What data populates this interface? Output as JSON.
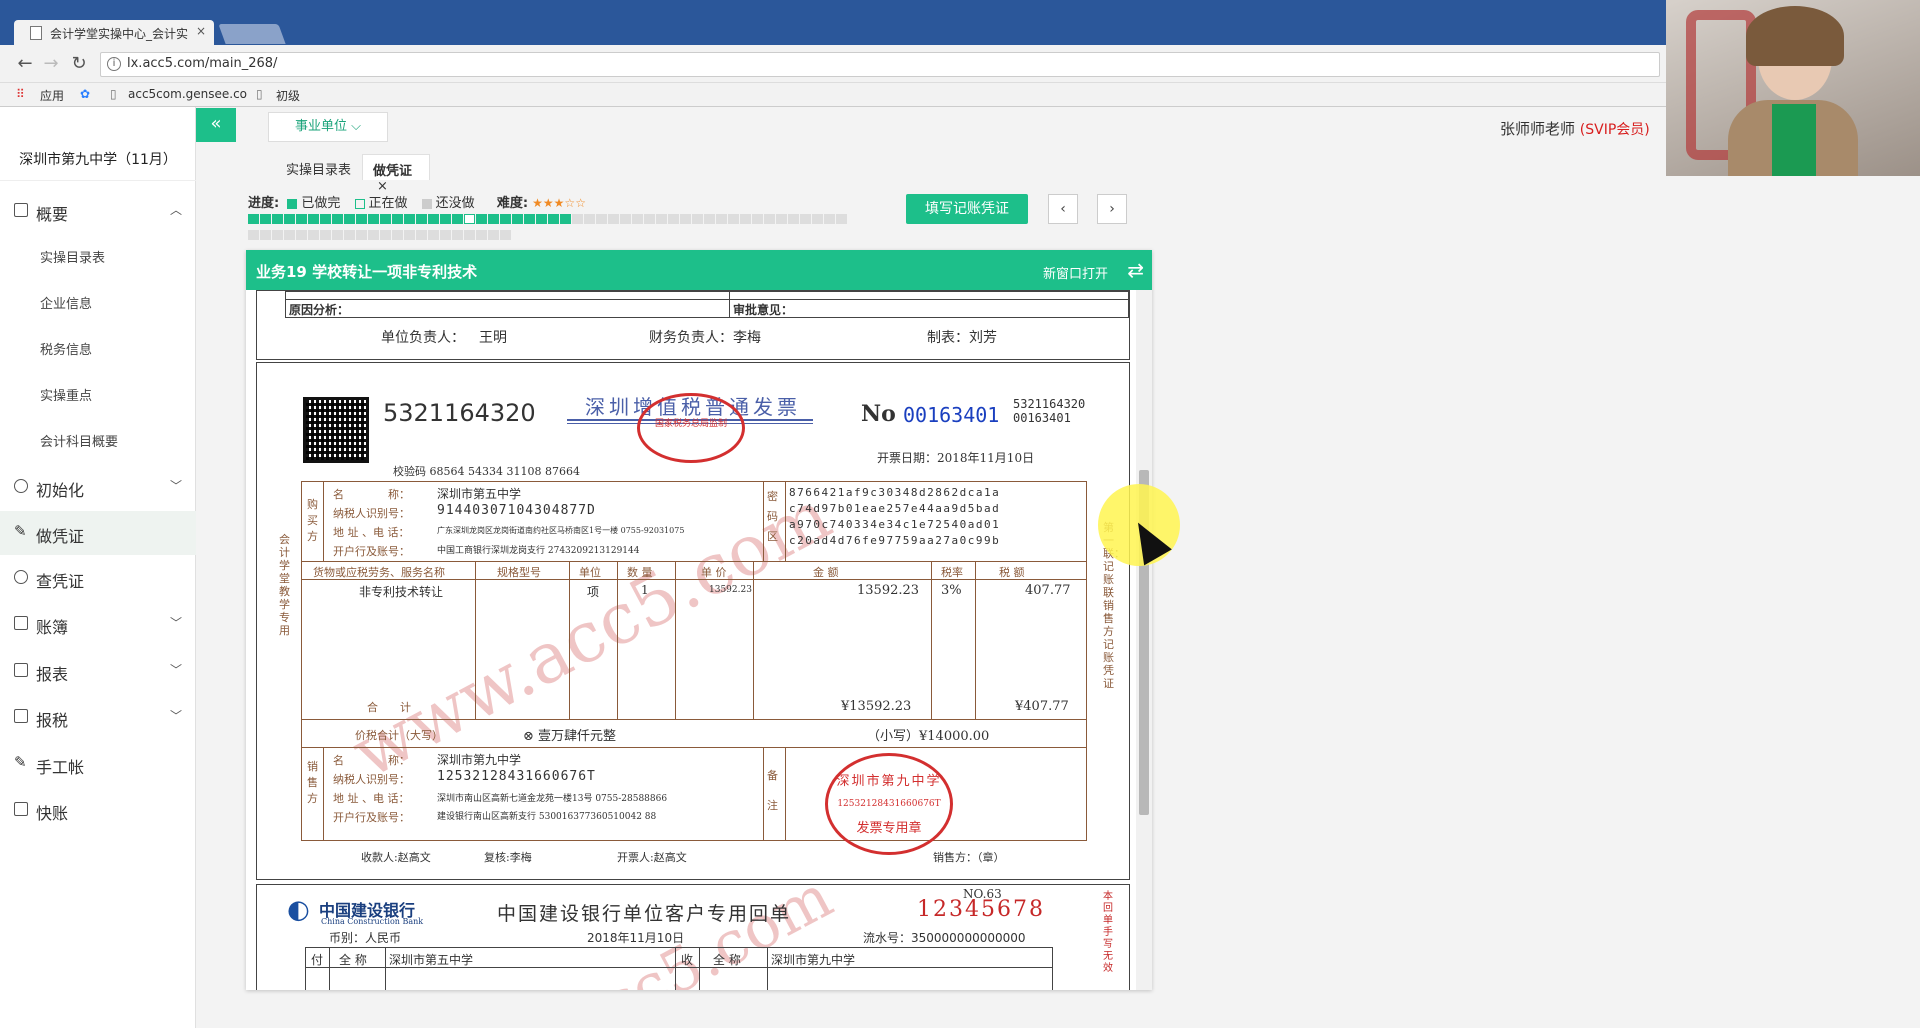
{
  "browser": {
    "tab_title": "会计学堂实操中心_会计实",
    "url": "lx.acc5.com/main_268/",
    "bookmarks": [
      "应用",
      "acc5com.gensee.co",
      "初级"
    ]
  },
  "header": {
    "unit_selector": "事业单位",
    "teacher_name": "张师师老师",
    "teacher_badge": "(SVIP会员)"
  },
  "sidebar": {
    "school": "深圳市第九中学（11月）",
    "items": [
      {
        "label": "概要",
        "expanded": true
      },
      {
        "label": "实操目录表"
      },
      {
        "label": "企业信息"
      },
      {
        "label": "税务信息"
      },
      {
        "label": "实操重点"
      },
      {
        "label": "会计科目概要"
      },
      {
        "label": "初始化"
      },
      {
        "label": "做凭证"
      },
      {
        "label": "查凭证"
      },
      {
        "label": "账簿"
      },
      {
        "label": "报表"
      },
      {
        "label": "报税"
      },
      {
        "label": "手工帐"
      },
      {
        "label": "快账"
      }
    ]
  },
  "tabs": [
    "实操目录表",
    "做凭证"
  ],
  "progress": {
    "label": "进度:",
    "done_label": "已做完",
    "doing_label": "正在做",
    "todo_label": "还没做",
    "difficulty_label": "难度:",
    "difficulty_stars": 3,
    "total_blocks": 72,
    "done_blocks": 18,
    "current_block": 19
  },
  "actions": {
    "fill_voucher": "填写记账凭证",
    "prev": "‹",
    "next": "›"
  },
  "panel": {
    "title": "业务19 学校转让一项非专利技术",
    "open_new_window": "新窗口打开"
  },
  "doc1": {
    "reason_label": "原因分析：",
    "approval_label": "审批意见：",
    "unit_head": "单位负责人：",
    "unit_head_name": "王明",
    "finance_head": "财务负责人：李梅",
    "preparer": "制表：刘芳"
  },
  "invoice": {
    "code": "5321164320",
    "title": "深圳增值税普通发票",
    "no_label": "No",
    "number": "00163401",
    "code_small": "5321164320",
    "number_small": "00163401",
    "check_code": "校验码 68564 54334 31108 87664",
    "date": "开票日期：2018年11月10日",
    "buyer_name": "深圳市第五中学",
    "buyer_tax_id": "91440307104304877D",
    "buyer_addr": "广东深圳龙岗区龙岗街道南约社区马桥南区1号一楼 0755-92031075",
    "buyer_bank": "中国工商银行深圳龙岗支行 2743209213129144",
    "cipher": [
      "8766421af9c30348d2862dca1a",
      "c74d97b01eae257e44aa9d5bad",
      "a970c740334e34c1e72540ad01",
      "c20ad4d76fe97759aa27a0c99b"
    ],
    "col_goods": "货物或应税劳务、服务名称",
    "col_spec": "规格型号",
    "col_unit": "单位",
    "col_qty": "数 量",
    "col_price": "单 价",
    "col_amount": "金 额",
    "col_rate": "税率",
    "col_tax": "税 额",
    "item_name": "非专利技术转让",
    "item_unit": "项",
    "item_qty": "1",
    "item_price": "13592.23",
    "item_amount": "13592.23",
    "item_rate": "3%",
    "item_tax": "407.77",
    "total_label": "合　　计",
    "total_amount": "¥13592.23",
    "total_tax": "¥407.77",
    "grand_label": "价税合计（大写）",
    "grand_words": "⊗ 壹万肆仟元整",
    "grand_small": "（小写）¥14000.00",
    "seller_name": "深圳市第九中学",
    "seller_tax_id": "12532128431660676T",
    "seller_addr": "深圳市南山区高新七道金龙苑一楼13号 0755-28588866",
    "seller_bank": "建设银行南山区高新支行 530016377360510042 88",
    "payee": "收款人:赵高文",
    "reviewer": "复核:李梅",
    "drawer": "开票人:赵高文",
    "seller_sign": "销售方：（章）",
    "side_left": "会计学堂教学专用",
    "side_right": "第一联：记账联 销售方记账凭证",
    "stamp_top": "深圳市第九中学",
    "stamp_id": "12532128431660676T",
    "stamp_bottom": "发票专用章",
    "tax_stamp": "国家税务总局监制"
  },
  "bank": {
    "name_cn": "中国建设银行",
    "name_en": "China Construction Bank",
    "title": "中国建设银行单位客户专用回单",
    "no": "NO.63",
    "number": "12345678",
    "currency": "币别：人民币",
    "date": "2018年11月10日",
    "serial": "流水号：350000000000000",
    "payer_name_label": "全 称",
    "payer_name": "深圳市第五中学",
    "payee_name_label": "全 称",
    "payee_name": "深圳市第九中学",
    "side": "本回单手写无效"
  }
}
